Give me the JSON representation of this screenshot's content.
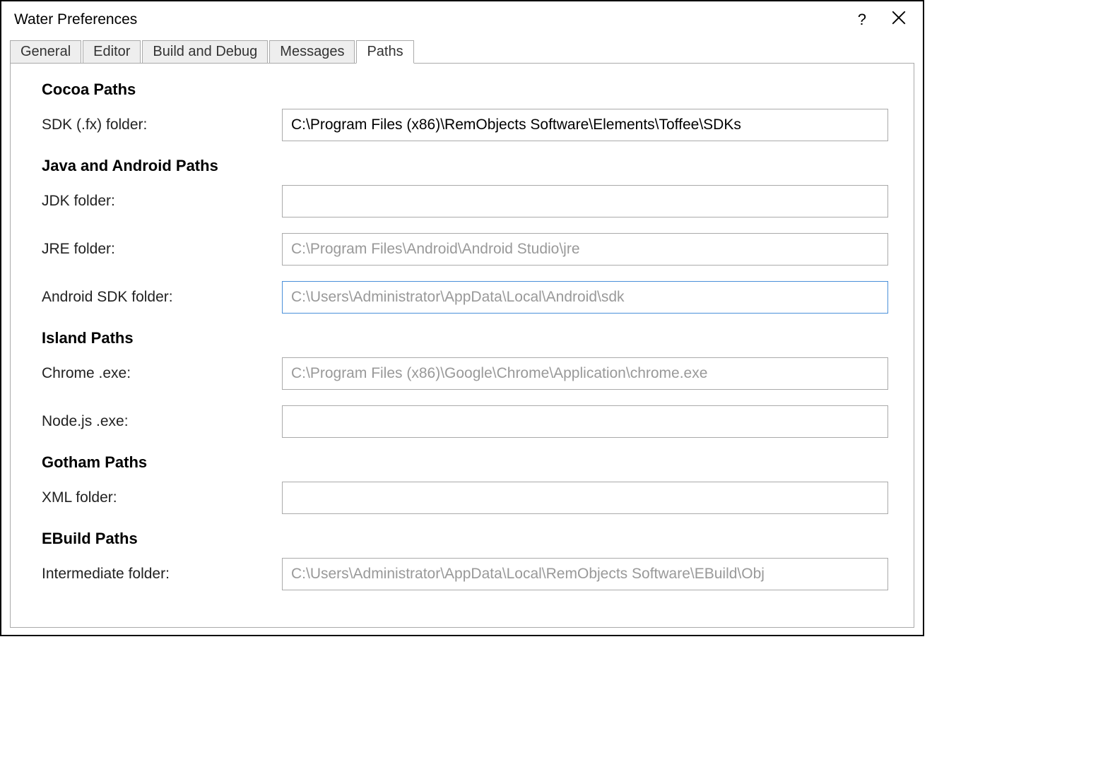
{
  "window": {
    "title": "Water Preferences"
  },
  "tabs": [
    {
      "label": "General"
    },
    {
      "label": "Editor"
    },
    {
      "label": "Build and Debug"
    },
    {
      "label": "Messages"
    },
    {
      "label": "Paths"
    }
  ],
  "sections": {
    "cocoa": {
      "header": "Cocoa Paths",
      "sdk_label": "SDK (.fx) folder:",
      "sdk_value": "C:\\Program Files (x86)\\RemObjects Software\\Elements\\Toffee\\SDKs"
    },
    "java": {
      "header": "Java and Android Paths",
      "jdk_label": "JDK folder:",
      "jdk_value": "",
      "jre_label": "JRE folder:",
      "jre_value": "",
      "jre_placeholder": "C:\\Program Files\\Android\\Android Studio\\jre",
      "android_label": "Android SDK folder:",
      "android_value": "",
      "android_placeholder": "C:\\Users\\Administrator\\AppData\\Local\\Android\\sdk"
    },
    "island": {
      "header": "Island Paths",
      "chrome_label": "Chrome .exe:",
      "chrome_value": "",
      "chrome_placeholder": "C:\\Program Files (x86)\\Google\\Chrome\\Application\\chrome.exe",
      "node_label": "Node.js .exe:",
      "node_value": ""
    },
    "gotham": {
      "header": "Gotham Paths",
      "xml_label": "XML folder:",
      "xml_value": ""
    },
    "ebuild": {
      "header": "EBuild Paths",
      "intermediate_label": "Intermediate folder:",
      "intermediate_value": "",
      "intermediate_placeholder": "C:\\Users\\Administrator\\AppData\\Local\\RemObjects Software\\EBuild\\Obj"
    }
  }
}
